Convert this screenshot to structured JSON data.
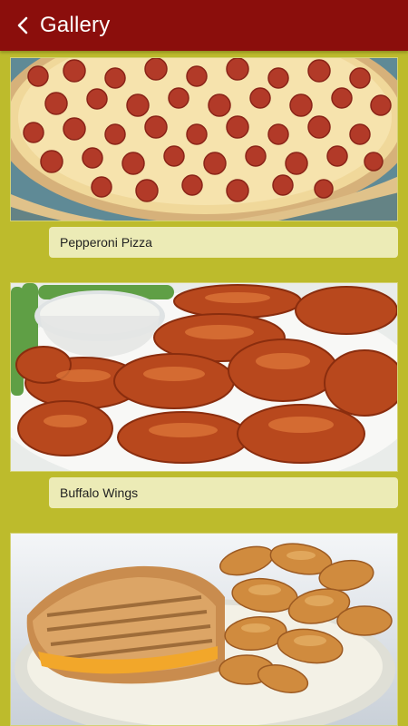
{
  "appbar": {
    "title": "Gallery",
    "back_icon": "chevron-left-icon",
    "background": "#8b0e0c"
  },
  "page": {
    "background": "#bdbb2c"
  },
  "gallery": {
    "items": [
      {
        "caption": "Pepperoni Pizza",
        "image": "pepperoni-pizza-photo"
      },
      {
        "caption": "Buffalo Wings",
        "image": "buffalo-wings-photo"
      },
      {
        "caption": "",
        "image": "grilled-sandwich-and-chips-photo"
      }
    ]
  }
}
